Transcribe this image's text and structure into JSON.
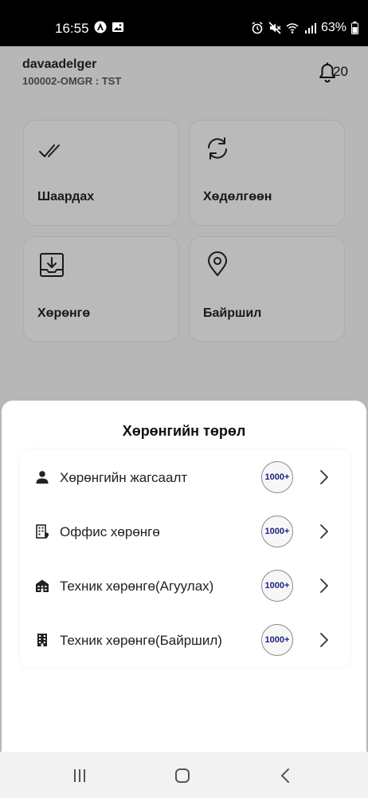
{
  "status_bar": {
    "time": "16:55",
    "battery": "63%"
  },
  "user": {
    "name": "davaadelger",
    "subtitle": "100002-OMGR : TST"
  },
  "notifications": {
    "count": "20"
  },
  "tiles": [
    {
      "label": "Шаардах",
      "icon": "double-check-icon"
    },
    {
      "label": "Хөдөлгөөн",
      "icon": "sync-icon"
    },
    {
      "label": "Хөрөнгө",
      "icon": "download-tray-icon"
    },
    {
      "label": "Байршил",
      "icon": "location-pin-icon"
    }
  ],
  "sheet": {
    "title": "Хөрөнгийн төрөл",
    "items": [
      {
        "label": "Хөрөнгийн жагсаалт",
        "badge": "1000+",
        "icon": "person-icon"
      },
      {
        "label": "Оффис хөрөнгө",
        "badge": "1000+",
        "icon": "office-building-icon"
      },
      {
        "label": "Техник хөрөнгө(Агуулах)",
        "badge": "1000+",
        "icon": "warehouse-icon"
      },
      {
        "label": "Техник хөрөнгө(Байршил)",
        "badge": "1000+",
        "icon": "building-icon"
      }
    ]
  },
  "colors": {
    "badge_text": "#1a237e",
    "overlay": "rgba(0,0,0,0.22)"
  }
}
